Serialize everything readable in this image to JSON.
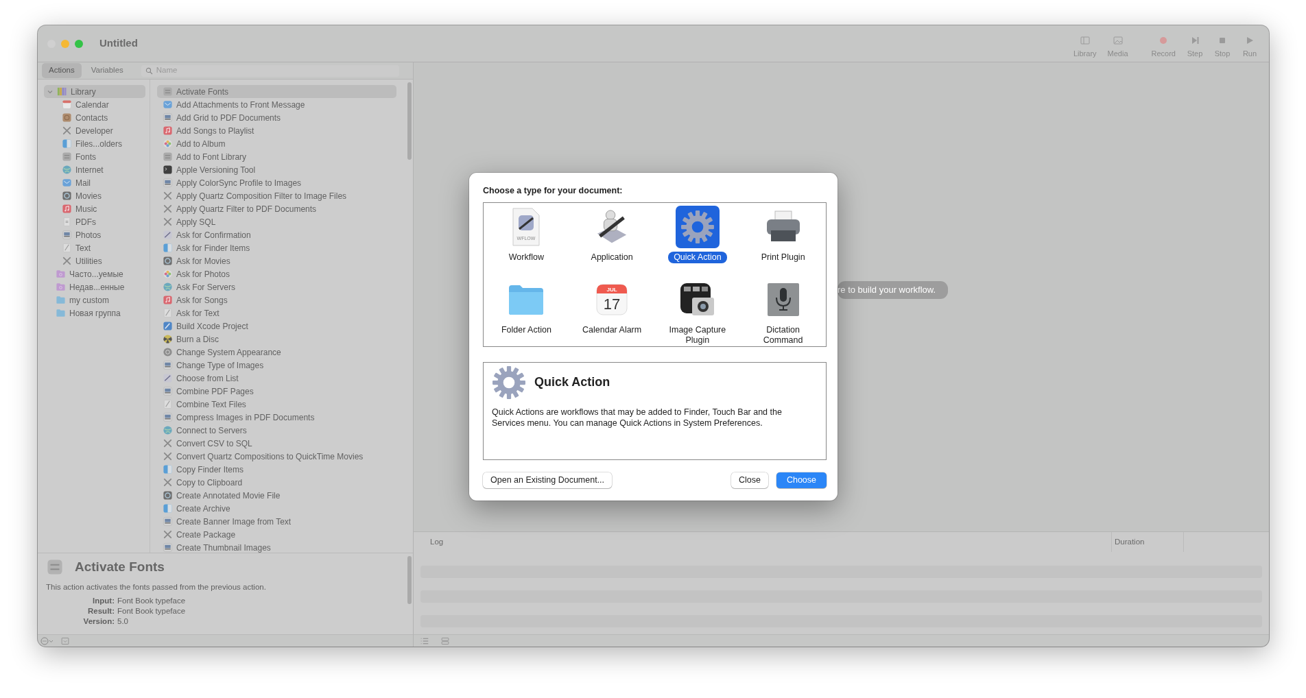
{
  "window": {
    "title": "Untitled"
  },
  "toolbar": [
    {
      "label": "Library",
      "kind": "library"
    },
    {
      "label": "Media",
      "kind": "media"
    },
    {
      "label": "Record",
      "kind": "record"
    },
    {
      "label": "Step",
      "kind": "step"
    },
    {
      "label": "Stop",
      "kind": "stop"
    },
    {
      "label": "Run",
      "kind": "run"
    }
  ],
  "library_tabs": [
    {
      "label": "Actions",
      "selected": true
    },
    {
      "label": "Variables",
      "selected": false
    }
  ],
  "search": {
    "placeholder": "Name"
  },
  "library_tree": [
    {
      "label": "Library",
      "kind": "books",
      "expanded": true,
      "selected": true,
      "children": [
        {
          "label": "Calendar",
          "kind": "calendar",
          "selected": false
        },
        {
          "label": "Contacts",
          "kind": "contacts",
          "selected": false
        },
        {
          "label": "Developer",
          "kind": "tools",
          "selected": false
        },
        {
          "label": "Files...olders",
          "kind": "finder",
          "selected": false
        },
        {
          "label": "Fonts",
          "kind": "fonts",
          "selected": false
        },
        {
          "label": "Internet",
          "kind": "globe",
          "selected": false
        },
        {
          "label": "Mail",
          "kind": "mail",
          "selected": false
        },
        {
          "label": "Movies",
          "kind": "movie",
          "selected": false
        },
        {
          "label": "Music",
          "kind": "music",
          "selected": false
        },
        {
          "label": "PDFs",
          "kind": "pdf",
          "selected": false
        },
        {
          "label": "Photos",
          "kind": "preview",
          "selected": false
        },
        {
          "label": "Text",
          "kind": "text",
          "selected": false
        },
        {
          "label": "Utilities",
          "kind": "tools",
          "selected": false
        }
      ]
    },
    {
      "label": "Часто...уемые",
      "kind": "smartfolder",
      "selected": false
    },
    {
      "label": "Недав...енные",
      "kind": "smartfolder",
      "selected": false
    },
    {
      "label": "my custom",
      "kind": "folder",
      "selected": false
    },
    {
      "label": "Новая группа",
      "kind": "folder",
      "selected": false
    }
  ],
  "actions": [
    {
      "label": "Activate Fonts",
      "kind": "fonts",
      "selected": true
    },
    {
      "label": "Add Attachments to Front Message",
      "kind": "mail",
      "selected": false
    },
    {
      "label": "Add Grid to PDF Documents",
      "kind": "preview",
      "selected": false
    },
    {
      "label": "Add Songs to Playlist",
      "kind": "music",
      "selected": false
    },
    {
      "label": "Add to Album",
      "kind": "photos",
      "selected": false
    },
    {
      "label": "Add to Font Library",
      "kind": "fonts",
      "selected": false
    },
    {
      "label": "Apple Versioning Tool",
      "kind": "terminal",
      "selected": false
    },
    {
      "label": "Apply ColorSync Profile to Images",
      "kind": "preview",
      "selected": false
    },
    {
      "label": "Apply Quartz Composition Filter to Image Files",
      "kind": "tools",
      "selected": false
    },
    {
      "label": "Apply Quartz Filter to PDF Documents",
      "kind": "tools",
      "selected": false
    },
    {
      "label": "Apply SQL",
      "kind": "tools",
      "selected": false
    },
    {
      "label": "Ask for Confirmation",
      "kind": "script",
      "selected": false
    },
    {
      "label": "Ask for Finder Items",
      "kind": "finder",
      "selected": false
    },
    {
      "label": "Ask for Movies",
      "kind": "movie",
      "selected": false
    },
    {
      "label": "Ask for Photos",
      "kind": "photos",
      "selected": false
    },
    {
      "label": "Ask For Servers",
      "kind": "globe",
      "selected": false
    },
    {
      "label": "Ask for Songs",
      "kind": "music",
      "selected": false
    },
    {
      "label": "Ask for Text",
      "kind": "text",
      "selected": false
    },
    {
      "label": "Build Xcode Project",
      "kind": "xcode",
      "selected": false
    },
    {
      "label": "Burn a Disc",
      "kind": "burn",
      "selected": false
    },
    {
      "label": "Change System Appearance",
      "kind": "appearance",
      "selected": false
    },
    {
      "label": "Change Type of Images",
      "kind": "preview",
      "selected": false
    },
    {
      "label": "Choose from List",
      "kind": "script",
      "selected": false
    },
    {
      "label": "Combine PDF Pages",
      "kind": "preview",
      "selected": false
    },
    {
      "label": "Combine Text Files",
      "kind": "text",
      "selected": false
    },
    {
      "label": "Compress Images in PDF Documents",
      "kind": "preview",
      "selected": false
    },
    {
      "label": "Connect to Servers",
      "kind": "globe",
      "selected": false
    },
    {
      "label": "Convert CSV to SQL",
      "kind": "tools",
      "selected": false
    },
    {
      "label": "Convert Quartz Compositions to QuickTime Movies",
      "kind": "tools",
      "selected": false
    },
    {
      "label": "Copy Finder Items",
      "kind": "finder",
      "selected": false
    },
    {
      "label": "Copy to Clipboard",
      "kind": "tools",
      "selected": false
    },
    {
      "label": "Create Annotated Movie File",
      "kind": "movie",
      "selected": false
    },
    {
      "label": "Create Archive",
      "kind": "finder",
      "selected": false
    },
    {
      "label": "Create Banner Image from Text",
      "kind": "preview",
      "selected": false
    },
    {
      "label": "Create Package",
      "kind": "tools",
      "selected": false
    },
    {
      "label": "Create Thumbnail Images",
      "kind": "preview",
      "selected": false
    }
  ],
  "description": {
    "title": "Activate Fonts",
    "text": "This action activates the fonts passed from the previous action.",
    "fields": [
      {
        "label": "Input:",
        "value": "Font Book typeface"
      },
      {
        "label": "Result:",
        "value": "Font Book typeface"
      },
      {
        "label": "Version:",
        "value": "5.0"
      }
    ]
  },
  "canvas": {
    "hint": "re to build your workflow."
  },
  "log": {
    "columns": [
      "Log",
      "Duration"
    ]
  },
  "dialog": {
    "prompt": "Choose a type for your document:",
    "types": [
      {
        "label": "Workflow",
        "kind": "workflow",
        "badge": "WFLOW",
        "selected": false
      },
      {
        "label": "Application",
        "kind": "application",
        "selected": false
      },
      {
        "label": "Quick Action",
        "kind": "quickaction",
        "selected": true
      },
      {
        "label": "Print Plugin",
        "kind": "printer",
        "selected": false
      },
      {
        "label": "Folder Action",
        "kind": "folder",
        "selected": false
      },
      {
        "label": "Calendar Alarm",
        "kind": "calendar",
        "month": "JUL",
        "day": "17",
        "selected": false
      },
      {
        "label": "Image Capture Plugin",
        "kind": "camera",
        "selected": false
      },
      {
        "label": "Dictation Command",
        "kind": "microphone",
        "selected": false
      }
    ],
    "detail": {
      "title": "Quick Action",
      "text": "Quick Actions are workflows that may be added to Finder, Touch Bar and the Services menu. You can manage Quick Actions in System Preferences."
    },
    "buttons": [
      {
        "label": "Open an Existing Document...",
        "kind": "secondary"
      },
      {
        "label": "Close",
        "kind": "secondary"
      },
      {
        "label": "Choose",
        "kind": "default"
      }
    ]
  }
}
